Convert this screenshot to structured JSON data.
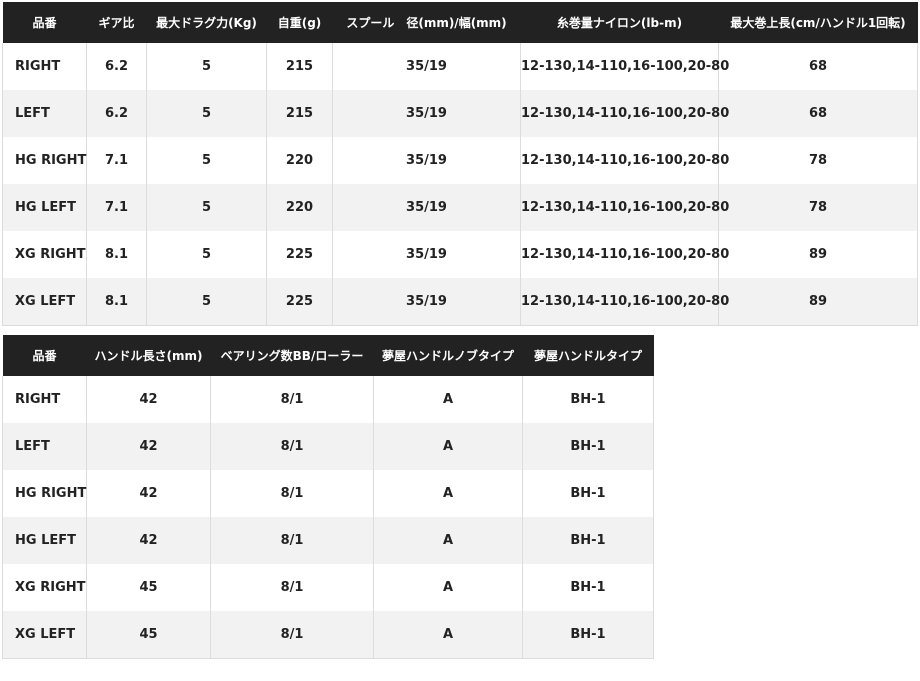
{
  "table1": {
    "headers": [
      "品番",
      "ギア比",
      "最大ドラグ力(Kg)",
      "自重(g)",
      "スプール　径(mm)/幅(mm)",
      "糸巻量ナイロン(lb-m)",
      "最大巻上長(cm/ハンドル1回転)"
    ],
    "rows": [
      [
        "RIGHT",
        "6.2",
        "5",
        "215",
        "35/19",
        "12-130,14-110,16-100,20-80",
        "68"
      ],
      [
        "LEFT",
        "6.2",
        "5",
        "215",
        "35/19",
        "12-130,14-110,16-100,20-80",
        "68"
      ],
      [
        "HG RIGHT",
        "7.1",
        "5",
        "220",
        "35/19",
        "12-130,14-110,16-100,20-80",
        "78"
      ],
      [
        "HG LEFT",
        "7.1",
        "5",
        "220",
        "35/19",
        "12-130,14-110,16-100,20-80",
        "78"
      ],
      [
        "XG RIGHT",
        "8.1",
        "5",
        "225",
        "35/19",
        "12-130,14-110,16-100,20-80",
        "89"
      ],
      [
        "XG LEFT",
        "8.1",
        "5",
        "225",
        "35/19",
        "12-130,14-110,16-100,20-80",
        "89"
      ]
    ]
  },
  "table2": {
    "headers": [
      "品番",
      "ハンドル長さ(mm)",
      "ベアリング数BB/ローラー",
      "夢屋ハンドルノブタイプ",
      "夢屋ハンドルタイプ"
    ],
    "rows": [
      [
        "RIGHT",
        "42",
        "8/1",
        "A",
        "BH-1"
      ],
      [
        "LEFT",
        "42",
        "8/1",
        "A",
        "BH-1"
      ],
      [
        "HG RIGHT",
        "42",
        "8/1",
        "A",
        "BH-1"
      ],
      [
        "HG LEFT",
        "42",
        "8/1",
        "A",
        "BH-1"
      ],
      [
        "XG RIGHT",
        "45",
        "8/1",
        "A",
        "BH-1"
      ],
      [
        "XG LEFT",
        "45",
        "8/1",
        "A",
        "BH-1"
      ]
    ]
  }
}
